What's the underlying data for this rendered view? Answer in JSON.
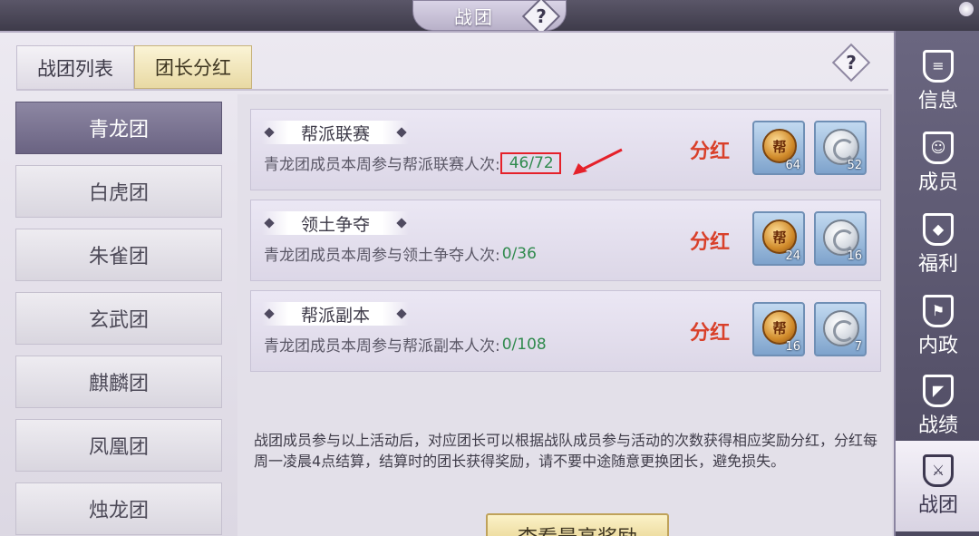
{
  "window": {
    "title": "战团",
    "help_glyph": "?"
  },
  "tabs": [
    {
      "label": "战团列表",
      "active": false
    },
    {
      "label": "团长分红",
      "active": true
    }
  ],
  "panel_help_glyph": "?",
  "teams": [
    {
      "label": "青龙团",
      "active": true
    },
    {
      "label": "白虎团",
      "active": false
    },
    {
      "label": "朱雀团",
      "active": false
    },
    {
      "label": "玄武团",
      "active": false
    },
    {
      "label": "麒麟团",
      "active": false
    },
    {
      "label": "凤凰团",
      "active": false
    },
    {
      "label": "烛龙团",
      "active": false
    }
  ],
  "activities": [
    {
      "title": "帮派联赛",
      "desc": "青龙团成员本周参与帮派联赛人次:",
      "count": "46/72",
      "highlighted": true,
      "dividend_label": "分红",
      "rewards": [
        {
          "icon": "gang-medal-icon",
          "glyph": "帮",
          "qty": "64"
        },
        {
          "icon": "silver-coin-icon",
          "qty": "52"
        }
      ]
    },
    {
      "title": "领土争夺",
      "desc": "青龙团成员本周参与领土争夺人次:",
      "count": "0/36",
      "highlighted": false,
      "dividend_label": "分红",
      "rewards": [
        {
          "icon": "gang-medal-icon",
          "glyph": "帮",
          "qty": "24"
        },
        {
          "icon": "silver-coin-icon",
          "qty": "16"
        }
      ]
    },
    {
      "title": "帮派副本",
      "desc": "青龙团成员本周参与帮派副本人次:",
      "count": "0/108",
      "highlighted": false,
      "dividend_label": "分红",
      "rewards": [
        {
          "icon": "gang-medal-icon",
          "glyph": "帮",
          "qty": "16"
        },
        {
          "icon": "silver-coin-icon",
          "qty": "7"
        }
      ]
    }
  ],
  "note": "战团成员参与以上活动后，对应团长可以根据战队成员参与活动的次数获得相应奖励分红，分红每周一凌晨4点结算，结算时的团长获得奖励，请不要中途随意更换团长，避免损失。",
  "view_button": "查看最高奖励",
  "nav": [
    {
      "label": "信息",
      "icon": "scroll-icon",
      "active": false
    },
    {
      "label": "成员",
      "icon": "member-icon",
      "active": false
    },
    {
      "label": "福利",
      "icon": "welfare-icon",
      "active": false
    },
    {
      "label": "内政",
      "icon": "flag-icon",
      "active": false
    },
    {
      "label": "战绩",
      "icon": "record-icon",
      "active": false
    },
    {
      "label": "战团",
      "icon": "guild-shield-icon",
      "active": true
    }
  ],
  "colors": {
    "count_green": "#2f8a4d",
    "dividend_red": "#d9402a",
    "highlight_red": "#e5212a"
  }
}
